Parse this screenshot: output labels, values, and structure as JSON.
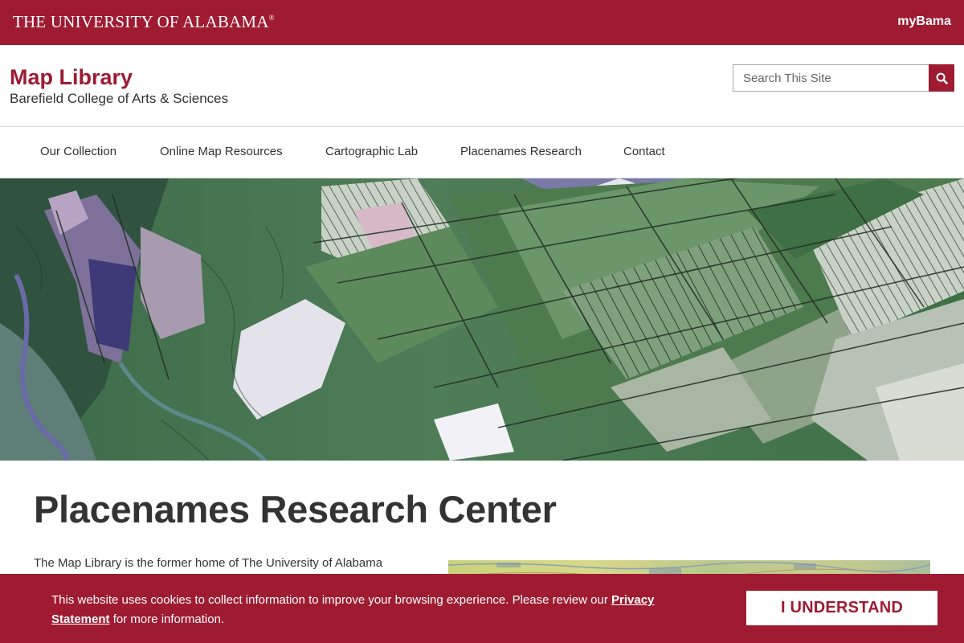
{
  "topbar": {
    "university_name": "THE UNIVERSITY OF ALABAMA",
    "registered_mark": "®",
    "mybama_label": "myBama"
  },
  "header": {
    "site_title": "Map Library",
    "site_subtitle": "Barefield College of Arts & Sciences",
    "search_placeholder": "Search This Site"
  },
  "nav": {
    "items": [
      {
        "label": "Our Collection"
      },
      {
        "label": "Online Map Resources"
      },
      {
        "label": "Cartographic Lab"
      },
      {
        "label": "Placenames Research"
      },
      {
        "label": "Contact"
      }
    ]
  },
  "main": {
    "page_title": "Placenames Research Center",
    "intro_text": "The Map Library is the former home of The University of Alabama"
  },
  "cookie_banner": {
    "text_before": "This website uses cookies to collect information to improve your browsing experience. Please review our ",
    "link_label": "Privacy Statement",
    "text_after": " for more information.",
    "button_label": "I UNDERSTAND"
  },
  "colors": {
    "brand_crimson": "#9e1b32",
    "text_dark": "#333333",
    "background": "#ffffff"
  },
  "icons": {
    "search": "search-icon"
  }
}
